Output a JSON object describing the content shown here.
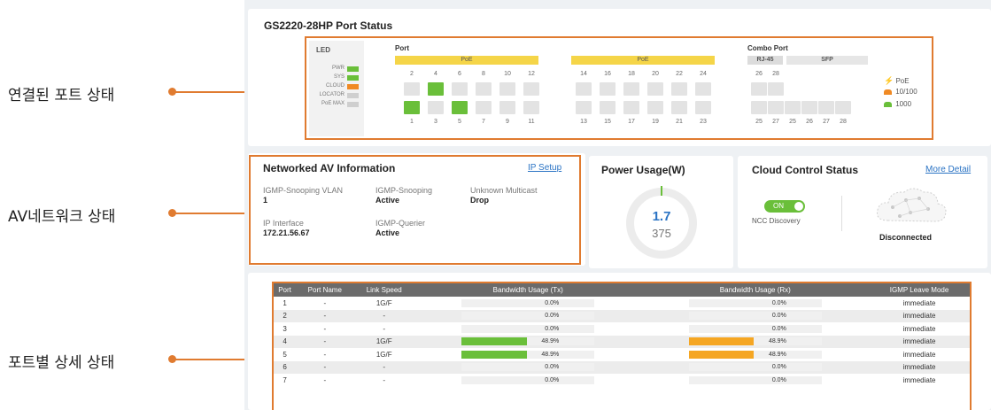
{
  "annotations": {
    "port_status": "연결된 포트 상태",
    "av_network": "AV네트워크 상태",
    "port_detail": "포트별 상세 상태"
  },
  "port_status_card": {
    "title": "GS2220-28HP Port Status",
    "led_title": "LED",
    "leds": [
      {
        "label": "PWR",
        "color": "#6abf3a"
      },
      {
        "label": "SYS",
        "color": "#6abf3a"
      },
      {
        "label": "CLOUD",
        "color": "#f08a24"
      },
      {
        "label": "LOCATOR",
        "color": "#cfcfcf"
      },
      {
        "label": "PoE MAX",
        "color": "#cfcfcf"
      }
    ],
    "port_title": "Port",
    "poe_label_1": "PoE",
    "poe_label_2": "PoE",
    "combo_title": "Combo Port",
    "rj45_label": "RJ-45",
    "sfp_label": "SFP",
    "top_ports_1": [
      "2",
      "4",
      "6",
      "8",
      "10",
      "12"
    ],
    "bottom_ports_1": [
      "1",
      "3",
      "5",
      "7",
      "9",
      "11"
    ],
    "top_ports_2": [
      "14",
      "16",
      "18",
      "20",
      "22",
      "24"
    ],
    "bottom_ports_2": [
      "13",
      "15",
      "17",
      "19",
      "21",
      "23"
    ],
    "combo_top": [
      "26",
      "28"
    ],
    "combo_bottom": [
      "25",
      "27",
      "25",
      "26",
      "27",
      "28"
    ],
    "active_ports": [
      "4",
      "1",
      "5"
    ],
    "legend": [
      {
        "label": "PoE",
        "icon": "lightning-icon",
        "color": "#f5c518"
      },
      {
        "label": "10/100",
        "icon": "port-icon",
        "color": "#f08a24"
      },
      {
        "label": "1000",
        "icon": "port-icon",
        "color": "#6abf3a"
      }
    ]
  },
  "av_card": {
    "title": "Networked AV Information",
    "ip_setup": "IP Setup",
    "fields": [
      {
        "label": "IGMP-Snooping VLAN",
        "value": "1"
      },
      {
        "label": "IGMP-Snooping",
        "value": "Active"
      },
      {
        "label": "Unknown Multicast",
        "value": "Drop"
      },
      {
        "label": "IP Interface",
        "value": "172.21.56.67"
      },
      {
        "label": "IGMP-Querier",
        "value": "Active"
      }
    ]
  },
  "power_card": {
    "title": "Power Usage(W)",
    "used": "1.7",
    "budget": "375"
  },
  "cloud_card": {
    "title": "Cloud Control Status",
    "more_detail": "More Detail",
    "toggle_label": "ON",
    "ncc_label": "NCC Discovery",
    "status": "Disconnected"
  },
  "port_table": {
    "headers": [
      "Port",
      "Port Name",
      "Link Speed",
      "Bandwidth Usage (Tx)",
      "Bandwidth Usage (Rx)",
      "IGMP Leave Mode"
    ],
    "rows": [
      {
        "port": "1",
        "name": "-",
        "speed": "1G/F",
        "tx": "0.0%",
        "tx_frac": 0,
        "rx": "0.0%",
        "rx_frac": 0,
        "mode": "immediate"
      },
      {
        "port": "2",
        "name": "-",
        "speed": "-",
        "tx": "0.0%",
        "tx_frac": 0,
        "rx": "0.0%",
        "rx_frac": 0,
        "mode": "immediate"
      },
      {
        "port": "3",
        "name": "-",
        "speed": "-",
        "tx": "0.0%",
        "tx_frac": 0,
        "rx": "0.0%",
        "rx_frac": 0,
        "mode": "immediate"
      },
      {
        "port": "4",
        "name": "-",
        "speed": "1G/F",
        "tx": "48.9%",
        "tx_frac": 0.489,
        "rx": "48.9%",
        "rx_frac": 0.489,
        "mode": "immediate"
      },
      {
        "port": "5",
        "name": "-",
        "speed": "1G/F",
        "tx": "48.9%",
        "tx_frac": 0.489,
        "rx": "48.9%",
        "rx_frac": 0.489,
        "mode": "immediate"
      },
      {
        "port": "6",
        "name": "-",
        "speed": "-",
        "tx": "0.0%",
        "tx_frac": 0,
        "rx": "0.0%",
        "rx_frac": 0,
        "mode": "immediate"
      },
      {
        "port": "7",
        "name": "-",
        "speed": "-",
        "tx": "0.0%",
        "tx_frac": 0,
        "rx": "0.0%",
        "rx_frac": 0,
        "mode": "immediate"
      }
    ],
    "tx_color": "#6abf3a",
    "rx_color": "#f5a623"
  },
  "colors": {
    "highlight": "#e07b30",
    "poe_bar": "#f5d548",
    "toggle_on": "#6abf3a"
  }
}
